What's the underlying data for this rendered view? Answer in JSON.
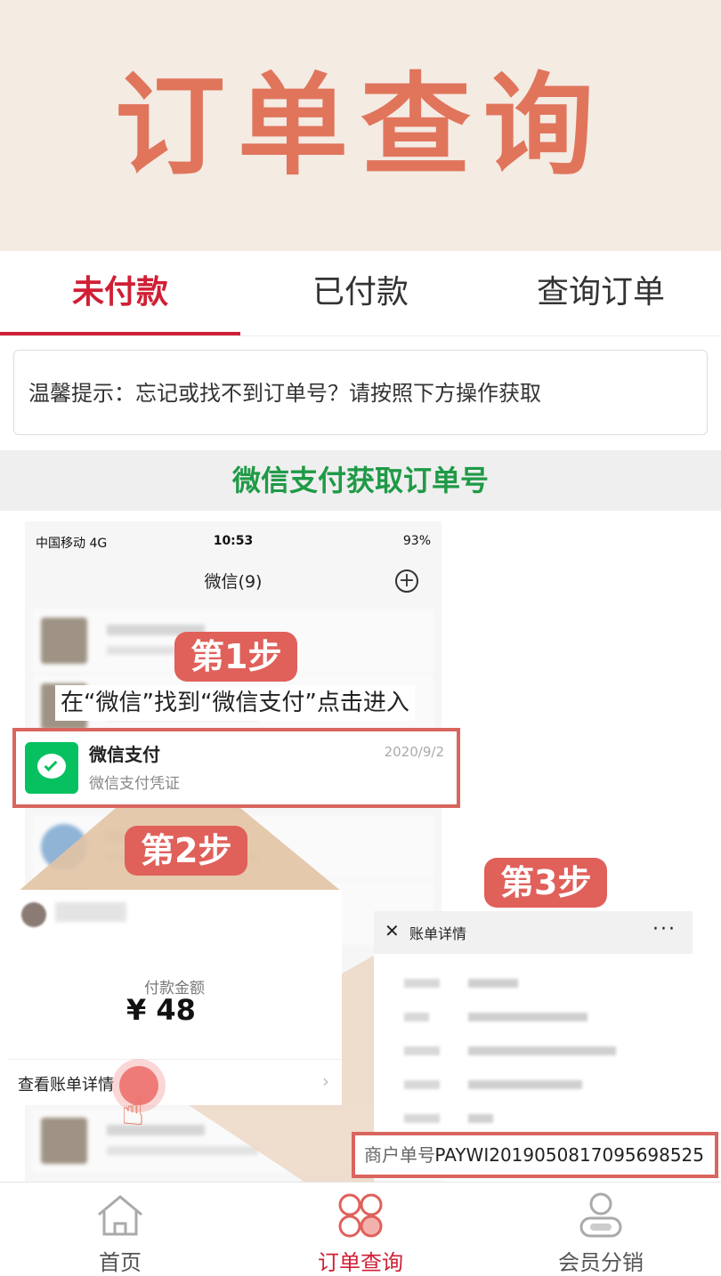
{
  "banner": {
    "title": "订单查询"
  },
  "tabs": [
    {
      "label": "未付款",
      "active": true
    },
    {
      "label": "已付款",
      "active": false
    },
    {
      "label": "查询订单",
      "active": false
    }
  ],
  "tip": "温馨提示：忘记或找不到订单号？请按照下方操作获取",
  "section": {
    "title": "微信支付获取订单号"
  },
  "guide": {
    "status_bar": {
      "carrier": "中国移动  4G",
      "time": "10:53",
      "battery": "93%"
    },
    "wechat_header": "微信(9)",
    "steps": [
      {
        "label": "第1步",
        "text": "在“微信”找到“微信支付”点击进入"
      },
      {
        "label": "第2步"
      },
      {
        "label": "第3步"
      }
    ],
    "pay_item": {
      "title": "微信支付",
      "subtitle": "微信支付凭证",
      "date": "2020/9/2"
    },
    "payment": {
      "amount_label": "付款金额",
      "amount": "¥ 48",
      "view_details": "查看账单详情"
    },
    "bill": {
      "title": "账单详情",
      "merchant_label": "商户单号",
      "merchant_no": "PAYWI2019050817095698525"
    }
  },
  "bottom_nav": [
    {
      "label": "首页",
      "icon": "home-icon",
      "active": false
    },
    {
      "label": "订单查询",
      "icon": "order-icon",
      "active": true
    },
    {
      "label": "会员分销",
      "icon": "member-icon",
      "active": false
    }
  ],
  "colors": {
    "accent": "#d01f35",
    "green": "#1f9a46",
    "banner_bg": "#f4ebe3",
    "step": "#e0605a"
  }
}
